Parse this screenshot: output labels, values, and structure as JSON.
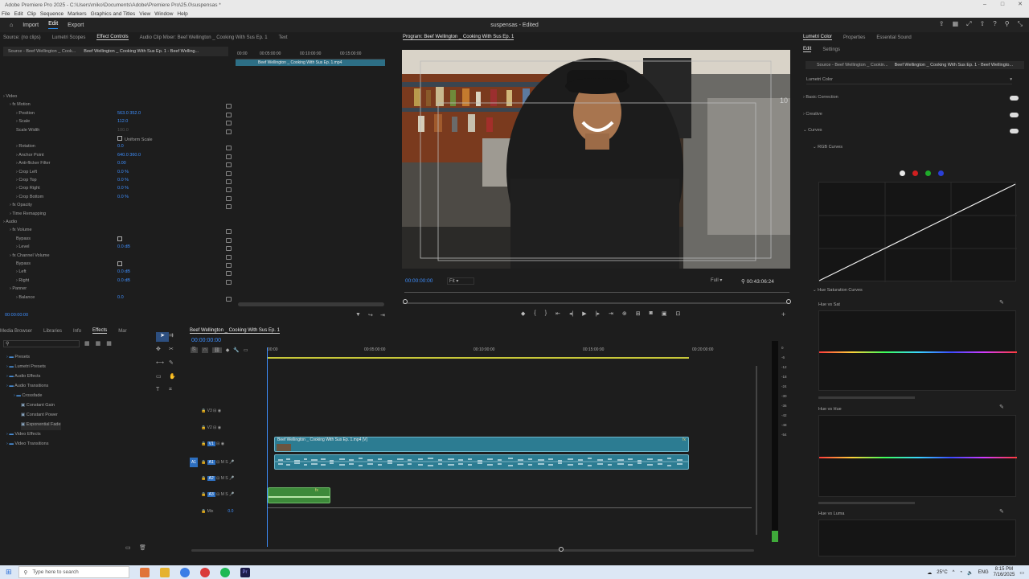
{
  "window": {
    "title": "Adobe Premiere Pro 2025 - C:\\Users\\miko\\Documents\\Adobe\\Premiere Pro\\25.0\\suspensas *"
  },
  "menu": [
    "File",
    "Edit",
    "Clip",
    "Sequence",
    "Markers",
    "Graphics and Titles",
    "View",
    "Window",
    "Help"
  ],
  "workspace": {
    "home_icon": "home-icon",
    "import": "Import",
    "edit": "Edit",
    "export": "Export",
    "doc_title": "suspensas - Edited"
  },
  "effect_controls": {
    "tabs": [
      "Source: (no clips)",
      "Lumetri Scopes",
      "Effect Controls",
      "Audio Clip Mixer: Beef Wellington _ Cooking With Sus Ep. 1",
      "Text"
    ],
    "source_label": "Source - Beef Wellington _ Cook...",
    "clip_label": "Beef Wellington _ Cooking With Sus Ep. 1 - Beef Welling...",
    "mini_clip": "Beef Wellington _ Cooking With Sus Ep. 1.mp4",
    "mini_times": [
      "00:00",
      "00:05:00:00",
      "00:10:00:00",
      "00:15:00:00"
    ],
    "timecode": "00:00:00:00",
    "rows": [
      {
        "label": "Video",
        "indent": 0,
        "value": ""
      },
      {
        "label": "fx  Motion",
        "indent": 1,
        "value": ""
      },
      {
        "label": "Position",
        "indent": 2,
        "value": "563.0    352.0"
      },
      {
        "label": "Scale",
        "indent": 2,
        "value": "112.0"
      },
      {
        "label": "Scale Width",
        "indent": 2,
        "value": "100.0"
      },
      {
        "label": "",
        "indent": 2,
        "value": "Uniform Scale"
      },
      {
        "label": "Rotation",
        "indent": 2,
        "value": "0.0"
      },
      {
        "label": "Anchor Point",
        "indent": 2,
        "value": "640.0    360.0"
      },
      {
        "label": "Anti-flicker Filter",
        "indent": 2,
        "value": "0.00"
      },
      {
        "label": "Crop Left",
        "indent": 2,
        "value": "0.0 %"
      },
      {
        "label": "Crop Top",
        "indent": 2,
        "value": "0.0 %"
      },
      {
        "label": "Crop Right",
        "indent": 2,
        "value": "0.0 %"
      },
      {
        "label": "Crop Bottom",
        "indent": 2,
        "value": "0.0 %"
      },
      {
        "label": "fx  Opacity",
        "indent": 1,
        "value": ""
      },
      {
        "label": "Time Remapping",
        "indent": 1,
        "value": ""
      },
      {
        "label": "Audio",
        "indent": 0,
        "value": ""
      },
      {
        "label": "fx  Volume",
        "indent": 1,
        "value": ""
      },
      {
        "label": "Bypass",
        "indent": 2,
        "value": ""
      },
      {
        "label": "Level",
        "indent": 2,
        "value": "0.0 dB"
      },
      {
        "label": "fx  Channel Volume",
        "indent": 1,
        "value": ""
      },
      {
        "label": "Bypass",
        "indent": 2,
        "value": ""
      },
      {
        "label": "Left",
        "indent": 2,
        "value": "0.0 dB"
      },
      {
        "label": "Right",
        "indent": 2,
        "value": "0.0 dB"
      },
      {
        "label": "Panner",
        "indent": 1,
        "value": ""
      },
      {
        "label": "Balance",
        "indent": 2,
        "value": "0.0"
      }
    ]
  },
  "program": {
    "title": "Program: Beef Wellington _ Cooking With Sus Ep. 1",
    "timecode": "00:00:00:00",
    "fit": "Fit",
    "quality": "Full",
    "duration": "00:43:06:24"
  },
  "effects_panel": {
    "tabs": [
      "Media Browser",
      "Libraries",
      "Info",
      "Effects",
      "Mar"
    ],
    "tree": [
      {
        "label": "Presets",
        "indent": 0
      },
      {
        "label": "Lumetri Presets",
        "indent": 0
      },
      {
        "label": "Audio Effects",
        "indent": 0
      },
      {
        "label": "Audio Transitions",
        "indent": 0
      },
      {
        "label": "Crossfade",
        "indent": 1
      },
      {
        "label": "Constant Gain",
        "indent": 2
      },
      {
        "label": "Constant Power",
        "indent": 2
      },
      {
        "label": "Exponential Fade",
        "indent": 2
      },
      {
        "label": "Video Effects",
        "indent": 0
      },
      {
        "label": "Video Transitions",
        "indent": 0
      }
    ]
  },
  "timeline": {
    "tab": "Beef Wellington _ Cooking With Sus Ep. 1",
    "timecode": "00:00:00:00",
    "ruler": [
      "00:00",
      "00:05:00:00",
      "00:10:00:00",
      "00:15:00:00",
      "00:20:00:00"
    ],
    "tracks": [
      "V3",
      "V2",
      "V1",
      "A1",
      "A2",
      "A3",
      "Mix"
    ],
    "mix_value": "0.0",
    "video_clip": "Beef Wellington _ Cooking With Sus Ep. 1.mp4 [V]",
    "meter_labels": [
      "0",
      "-6",
      "-12",
      "-18",
      "-24",
      "-30",
      "-36",
      "-42",
      "-48",
      "-54"
    ]
  },
  "lumetri": {
    "tabs": [
      "Lumetri Color",
      "Properties",
      "Essential Sound"
    ],
    "subtabs": [
      "Edit",
      "Settings"
    ],
    "source": "Source - Beef Wellington _ Cookin...",
    "clip": "Beef Wellington _ Cooking With Sus Ep. 1 - Beef Wellingto...",
    "effect": "Lumetri Color",
    "sections": [
      "Basic Correction",
      "Creative",
      "Curves"
    ],
    "rgb_curves": "RGB Curves",
    "hue_sat_curves": "Hue Saturation Curves",
    "hue_vs_sat": "Hue vs Sat",
    "hue_vs_hue": "Hue vs Hue",
    "hue_vs_luma": "Hue vs Luma",
    "channel_colors": [
      "#e8e8e8",
      "#d01f1f",
      "#1faa2a",
      "#2a3fd6"
    ]
  },
  "taskbar": {
    "search_placeholder": "Type here to search",
    "weather": "25°C",
    "language": "ENG",
    "time": "8:15 PM",
    "date": "7/16/2025"
  }
}
